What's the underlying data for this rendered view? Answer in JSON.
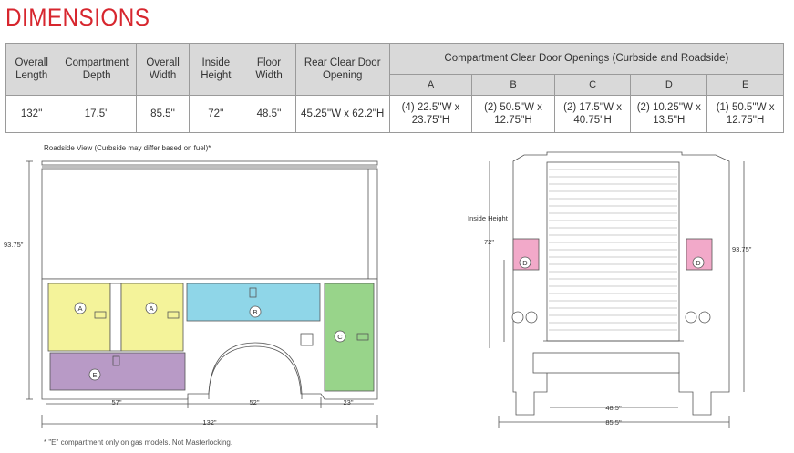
{
  "title": "DIMENSIONS",
  "table": {
    "headers": {
      "overall_length": "Overall Length",
      "compartment_depth": "Compartment Depth",
      "overall_width": "Overall Width",
      "inside_height": "Inside Height",
      "floor_width": "Floor Width",
      "rear_clear": "Rear Clear Door Opening",
      "compartment_openings": "Compartment Clear Door Openings (Curbside and Roadside)"
    },
    "letters": [
      "A",
      "B",
      "C",
      "D",
      "E"
    ],
    "values": {
      "overall_length": "132''",
      "compartment_depth": "17.5''",
      "overall_width": "85.5''",
      "inside_height": "72''",
      "floor_width": "48.5''",
      "rear_clear": "45.25''W x 62.2''H",
      "A": "(4) 22.5''W x 23.75''H",
      "B": "(2) 50.5''W x 12.75''H",
      "C": "(2) 17.5''W x 40.75''H",
      "D": "(2) 10.25''W x 13.5''H",
      "E": "(1) 50.5''W x 12.75''H"
    }
  },
  "side_view": {
    "caption": "Roadside View (Curbside may differ based on fuel)*",
    "height_label": "93.75\"",
    "dim_57": "57\"",
    "dim_52": "52\"",
    "dim_23": "23\"",
    "dim_132": "132\"",
    "markers": {
      "A": "A",
      "B": "B",
      "C": "C",
      "E": "E"
    }
  },
  "rear_view": {
    "inside_height_label": "Inside Height",
    "inside_height_value": "72\"",
    "height_label": "93.75\"",
    "floor_width": "48.5\"",
    "overall_width": "85.5\"",
    "marker_d": "D"
  },
  "footnote": "* \"E\" compartment only on gas models. Not Masterlocking.",
  "colors": {
    "title": "#d7262e",
    "A": "#f4f39a",
    "B": "#8fd6e8",
    "C": "#98d48a",
    "D": "#f2a9c9",
    "E": "#b89ac6"
  }
}
